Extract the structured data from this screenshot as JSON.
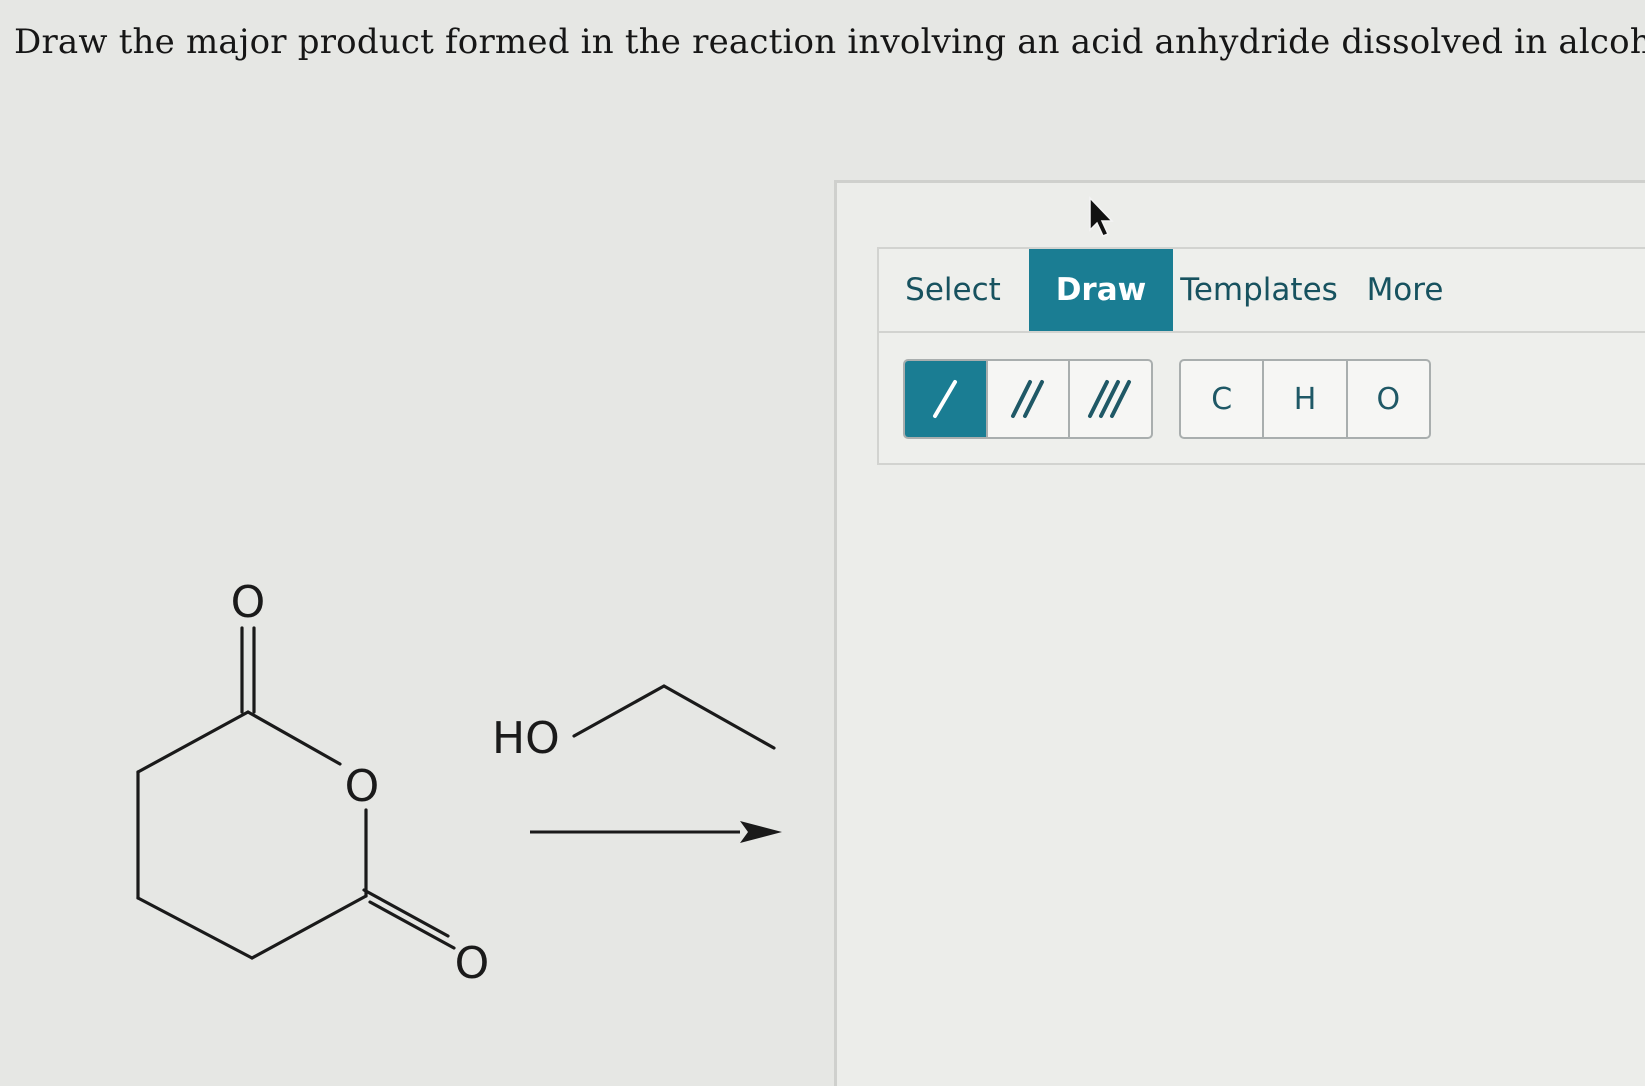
{
  "question": {
    "text": "Draw the major product formed in the reaction involving an acid anhydride dissolved in alcohol."
  },
  "reaction": {
    "anhydride_carbonyl_top_label": "O",
    "ring_oxygen_label": "O",
    "anhydride_carbonyl_bottom_label": "O",
    "reagent_label": "HO"
  },
  "editor": {
    "tabs": [
      {
        "label": "Select",
        "active": false
      },
      {
        "label": "Draw",
        "active": true
      },
      {
        "label": "Templates",
        "active": false
      },
      {
        "label": "More",
        "active": false
      }
    ],
    "bond_tools": [
      {
        "icon": "single-bond-icon",
        "active": true
      },
      {
        "icon": "double-bond-icon",
        "active": false
      },
      {
        "icon": "triple-bond-icon",
        "active": false
      }
    ],
    "atom_tools": [
      {
        "label": "C"
      },
      {
        "label": "H"
      },
      {
        "label": "O"
      }
    ]
  },
  "colors": {
    "accent": "#1a7d93",
    "tab_text": "#17525f",
    "background": "#e6e7e4"
  }
}
